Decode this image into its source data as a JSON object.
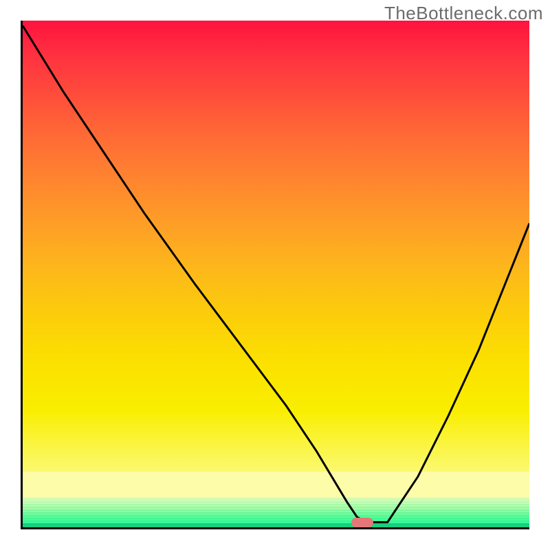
{
  "watermark": "TheBottleneck.com",
  "colors": {
    "top": "#FF123D",
    "mid": "#FE9E27",
    "yellow": "#F9EE00",
    "green": "#18CF7F",
    "curve": "#000000",
    "marker": "#E47878"
  },
  "chart_data": {
    "type": "line",
    "title": "",
    "xlabel": "",
    "ylabel": "",
    "xlim": [
      0,
      100
    ],
    "ylim": [
      0,
      100
    ],
    "series": [
      {
        "name": "bottleneck-curve",
        "x": [
          0,
          8,
          16,
          24,
          29,
          34,
          40,
          46,
          52,
          58,
          61,
          64,
          66,
          68,
          72,
          78,
          84,
          90,
          96,
          100
        ],
        "y": [
          99,
          86,
          74,
          62,
          55,
          48,
          40,
          32,
          24,
          15,
          10,
          5,
          2,
          1,
          1,
          10,
          22,
          35,
          50,
          60
        ]
      }
    ],
    "marker": {
      "x": 67,
      "y": 1
    },
    "annotations": []
  }
}
